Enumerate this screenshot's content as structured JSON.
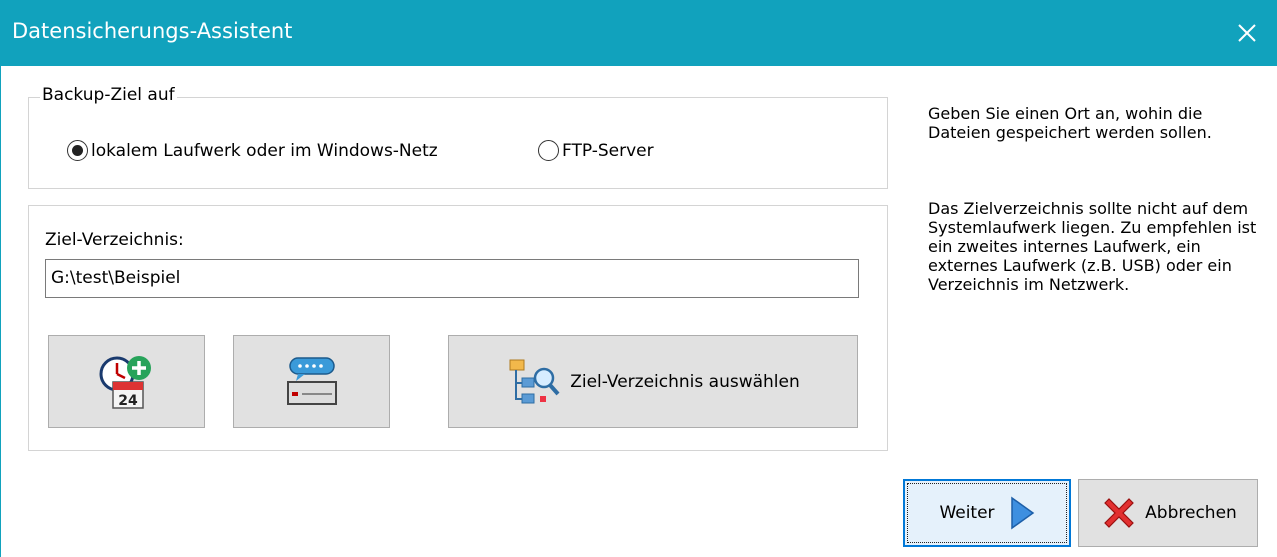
{
  "window": {
    "title": "Datensicherungs-Assistent"
  },
  "target_group": {
    "legend": "Backup-Ziel auf",
    "options": [
      {
        "label": "lokalem Laufwerk oder im Windows-Netz",
        "selected": true
      },
      {
        "label": "FTP-Server",
        "selected": false
      }
    ]
  },
  "directory": {
    "label": "Ziel-Verzeichnis:",
    "value": "G:\\test\\Beispiel"
  },
  "buttons": {
    "schedule_icon": "calendar-clock-add-icon",
    "calendar_day": "24",
    "message_icon": "speech-bubble-icon",
    "choose_dir_label": "Ziel-Verzeichnis auswählen",
    "next_label": "Weiter",
    "cancel_label": "Abbrechen"
  },
  "help": {
    "paragraph1": "Geben Sie einen Ort an, wohin die Dateien gespeichert werden sollen.",
    "paragraph2": "Das Zielverzeichnis sollte nicht auf dem Systemlaufwerk liegen. Zu empfehlen ist ein zweites internes Laufwerk, ein externes Laufwerk (z.B. USB) oder ein Verzeichnis im Netzwerk."
  },
  "colors": {
    "titlebar": "#11a2bd",
    "accent": "#0078d7"
  }
}
